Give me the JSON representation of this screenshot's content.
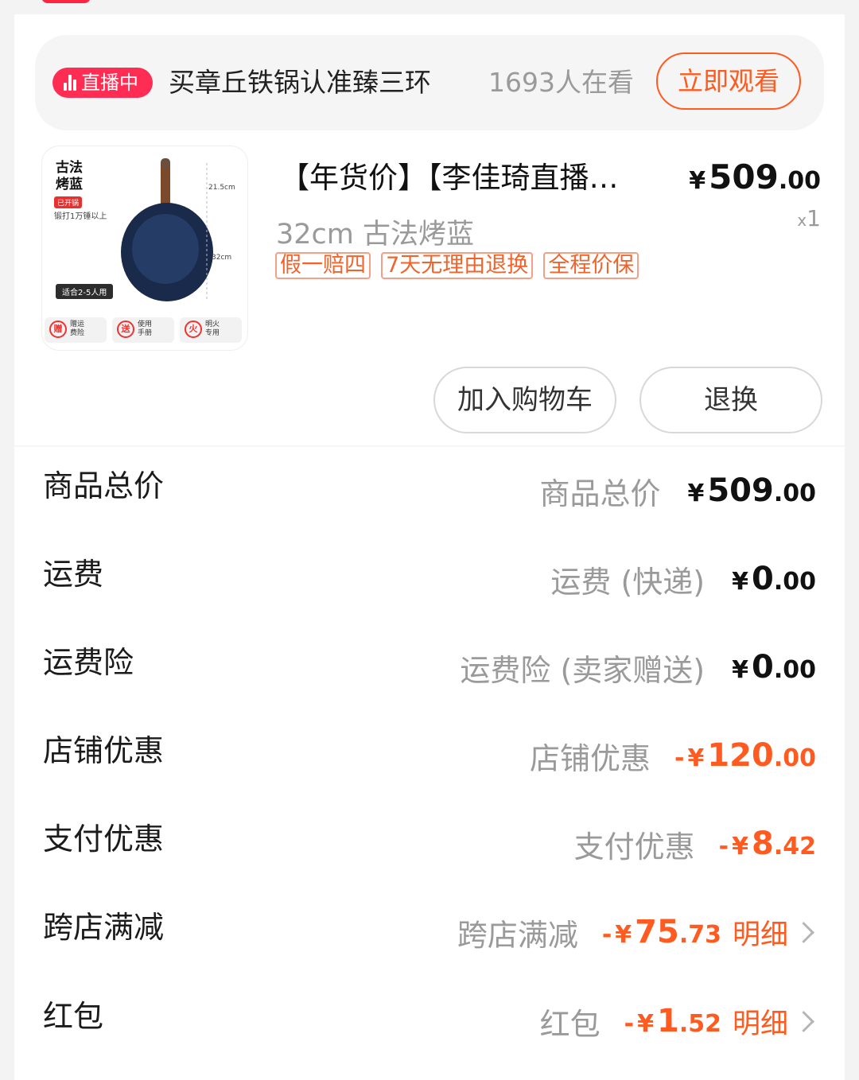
{
  "live": {
    "badge": "直播中",
    "title": "买章丘铁锅认准臻三环",
    "viewers": "1693人在看",
    "watch_button": "立即观看"
  },
  "product": {
    "title": "【年货价】【李佳琦直播…",
    "price_symbol": "¥",
    "price_int": "509",
    "price_dec": ".00",
    "spec": "32cm 古法烤蓝",
    "qty_prefix": "x",
    "qty": "1",
    "tags": [
      "假一赔四",
      "7天无理由退换",
      "全程价保"
    ],
    "image": {
      "title_line1": "古法",
      "title_line2": "烤蓝",
      "open_tag": "已开锅",
      "forge": "锻打1万锤以上",
      "suitable": "适合2-5人用",
      "dim_handle": "21.5cm",
      "dim_pan": "32cm",
      "features": [
        {
          "icon": "赠",
          "line1": "赠运",
          "line2": "费险"
        },
        {
          "icon": "送",
          "line1": "使用",
          "line2": "手册"
        },
        {
          "icon": "火",
          "line1": "明火",
          "line2": "专用"
        }
      ]
    }
  },
  "actions": {
    "add_to_cart": "加入购物车",
    "return_exchange": "退换"
  },
  "summary": [
    {
      "label": "商品总价",
      "sub": "商品总价",
      "sign": "",
      "yen": "¥",
      "int": "509",
      "dec": ".00",
      "discount": false,
      "detail": ""
    },
    {
      "label": "运费",
      "sub": "运费 (快递)",
      "sign": "",
      "yen": "¥",
      "int": "0",
      "dec": ".00",
      "discount": false,
      "detail": ""
    },
    {
      "label": "运费险",
      "sub": "运费险 (卖家赠送)",
      "sign": "",
      "yen": "¥",
      "int": "0",
      "dec": ".00",
      "discount": false,
      "detail": ""
    },
    {
      "label": "店铺优惠",
      "sub": "店铺优惠",
      "sign": "-",
      "yen": "¥",
      "int": "120",
      "dec": ".00",
      "discount": true,
      "detail": ""
    },
    {
      "label": "支付优惠",
      "sub": "支付优惠",
      "sign": "-",
      "yen": "¥",
      "int": "8",
      "dec": ".42",
      "discount": true,
      "detail": ""
    },
    {
      "label": "跨店满减",
      "sub": "跨店满减",
      "sign": "-",
      "yen": "¥",
      "int": "75",
      "dec": ".73",
      "discount": true,
      "detail": "明细"
    },
    {
      "label": "红包",
      "sub": "红包",
      "sign": "-",
      "yen": "¥",
      "int": "1",
      "dec": ".52",
      "discount": true,
      "detail": "明细"
    }
  ],
  "colors": {
    "accent": "#ff5a1f",
    "live_red": "#ff2d54",
    "muted": "#9a9a9a"
  }
}
